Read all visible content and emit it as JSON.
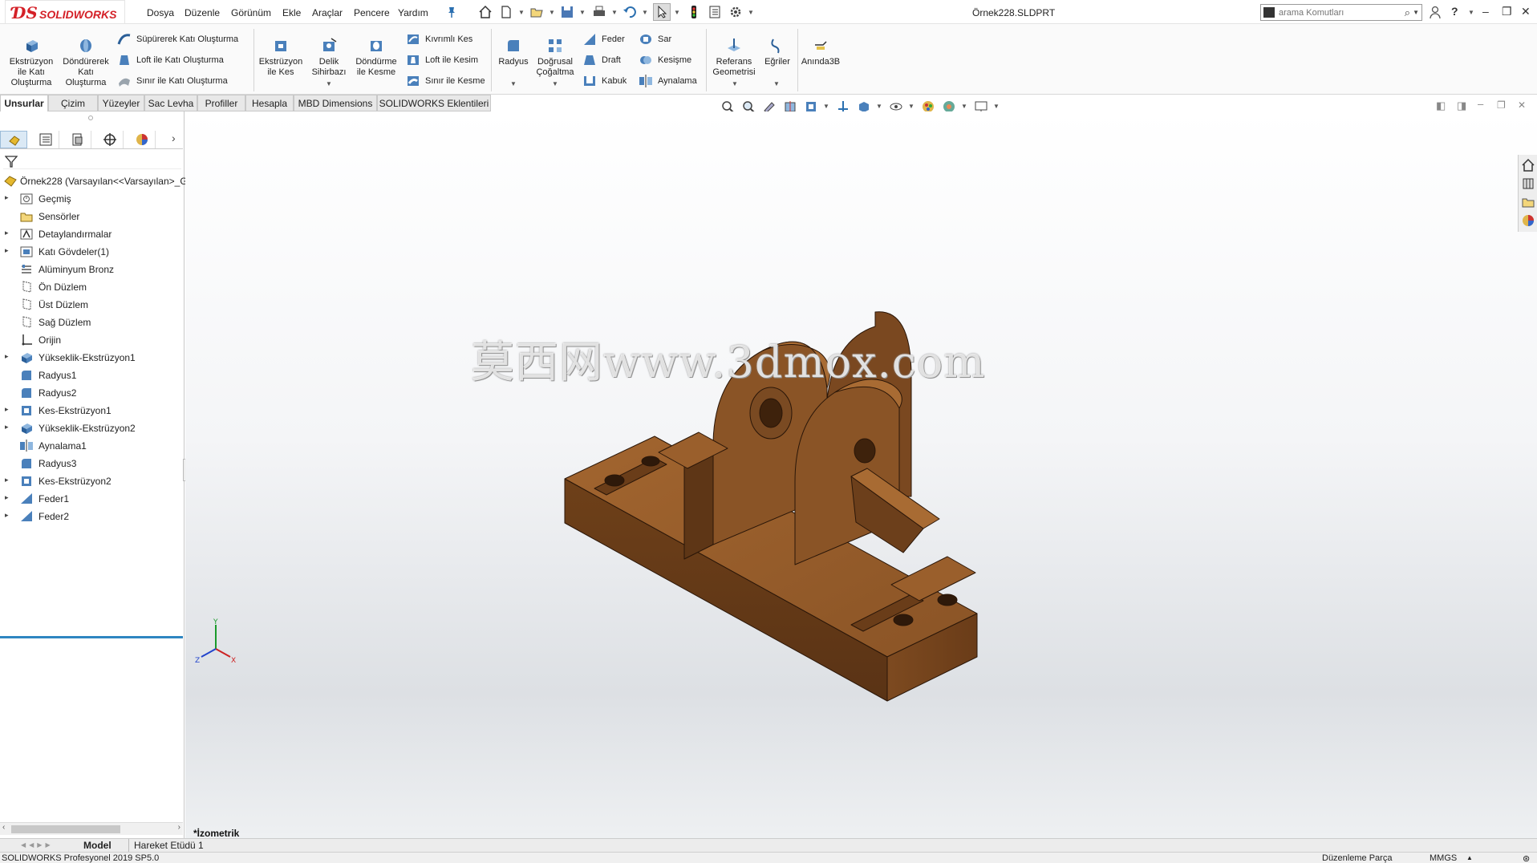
{
  "app": {
    "logo_text": "SOLIDWORKS",
    "document_title": "Örnek228.SLDPRT"
  },
  "menu": [
    "Dosya",
    "Düzenle",
    "Görünüm",
    "Ekle",
    "Araçlar",
    "Pencere",
    "Yardım"
  ],
  "search": {
    "placeholder": "arama Komutları"
  },
  "ribbon": {
    "extrude_boss": "Ekstrüzyon ile Katı Oluşturma",
    "revolve_boss": "Döndürerek Katı Oluşturma",
    "swept_boss": "Süpürerek Katı Oluşturma",
    "loft_boss": "Loft ile Katı Oluşturma",
    "boundary_boss": "Sınır ile Katı Oluşturma",
    "extrude_cut": "Ekstrüzyon ile Kes",
    "hole_wizard": "Delik Sihirbazı",
    "revolve_cut": "Döndürme ile Kesme",
    "swept_cut": "Kıvrımlı Kes",
    "loft_cut": "Loft ile Kesim",
    "boundary_cut": "Sınır ile Kesme",
    "fillet": "Radyus",
    "linear_pattern": "Doğrusal Çoğaltma",
    "rib": "Feder",
    "draft": "Draft",
    "shell": "Kabuk",
    "wrap": "Sar",
    "intersect": "Kesişme",
    "mirror": "Aynalama",
    "ref_geometry": "Referans Geometrisi",
    "curves": "Eğriler",
    "instant3d": "Anında3B"
  },
  "tabs": [
    "Unsurlar",
    "Çizim",
    "Yüzeyler",
    "Sac Levha",
    "Profiller",
    "Hesapla",
    "MBD Dimensions",
    "SOLIDWORKS Eklentileri"
  ],
  "feature_tree": {
    "root": "Örnek228  (Varsayılan<<Varsayılan>_G",
    "items": [
      {
        "label": "Geçmiş"
      },
      {
        "label": "Sensörler"
      },
      {
        "label": "Detaylandırmalar"
      },
      {
        "label": "Katı Gövdeler(1)"
      },
      {
        "label": "Alüminyum Bronz"
      },
      {
        "label": "Ön Düzlem"
      },
      {
        "label": "Üst Düzlem"
      },
      {
        "label": "Sağ Düzlem"
      },
      {
        "label": "Orijin"
      },
      {
        "label": "Yükseklik-Ekstrüzyon1"
      },
      {
        "label": "Radyus1"
      },
      {
        "label": "Radyus2"
      },
      {
        "label": "Kes-Ekstrüzyon1"
      },
      {
        "label": "Yükseklik-Ekstrüzyon2"
      },
      {
        "label": "Aynalama1"
      },
      {
        "label": "Radyus3"
      },
      {
        "label": "Kes-Ekstrüzyon2"
      },
      {
        "label": "Feder1"
      },
      {
        "label": "Feder2"
      }
    ]
  },
  "viewport": {
    "view_name": "*İzometrik",
    "watermark": "莫西网www.3dmox.com",
    "axis_labels": {
      "x": "X",
      "y": "Y",
      "z": "Z"
    }
  },
  "bottom_tabs": [
    "Model",
    "Hareket Etüdü 1"
  ],
  "status": {
    "product": "SOLIDWORKS Profesyonel 2019 SP5.0",
    "mode": "Düzenleme Parça",
    "units": "MMGS"
  },
  "colors": {
    "part": "#7a4a22",
    "part_top": "#9a5f2c",
    "part_dark": "#5a3315",
    "accent": "#2e86c1",
    "brand": "#d42027"
  }
}
